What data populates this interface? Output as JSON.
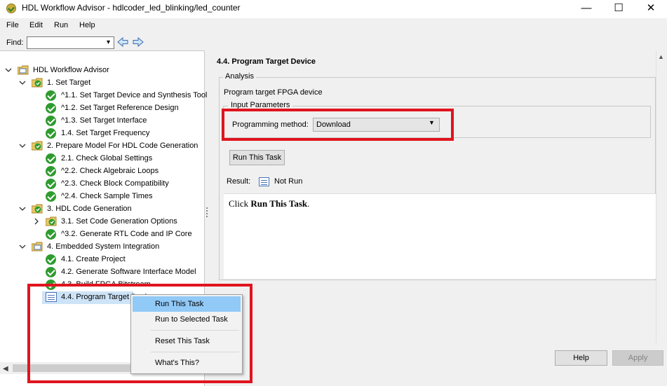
{
  "window": {
    "title": "HDL Workflow Advisor - hdlcoder_led_blinking/led_counter",
    "minimize": "—",
    "maximize": "☐",
    "close": "✕"
  },
  "menubar": [
    "File",
    "Edit",
    "Run",
    "Help"
  ],
  "find": {
    "label": "Find:",
    "value": "",
    "dropdown_glyph": "▾",
    "back_icon": "back-arrow-icon",
    "forward_icon": "forward-arrow-icon"
  },
  "tree": {
    "root": "HDL Workflow Advisor",
    "items": [
      {
        "label": "1. Set Target"
      },
      {
        "label": "^1.1. Set Target Device and Synthesis Tool"
      },
      {
        "label": "^1.2. Set Target Reference Design"
      },
      {
        "label": "^1.3. Set Target Interface"
      },
      {
        "label": "1.4. Set Target Frequency"
      },
      {
        "label": "2. Prepare Model For HDL Code Generation"
      },
      {
        "label": "2.1. Check Global Settings"
      },
      {
        "label": "^2.2. Check Algebraic Loops"
      },
      {
        "label": "^2.3. Check Block Compatibility"
      },
      {
        "label": "^2.4. Check Sample Times"
      },
      {
        "label": "3. HDL Code Generation"
      },
      {
        "label": "3.1. Set Code Generation Options"
      },
      {
        "label": "^3.2. Generate RTL Code and IP Core"
      },
      {
        "label": "4. Embedded System Integration"
      },
      {
        "label": "4.1. Create Project"
      },
      {
        "label": "4.2. Generate Software Interface Model"
      },
      {
        "label": "4.3. Build FPGA Bitstream"
      },
      {
        "label": "4.4. Program Target Device"
      }
    ]
  },
  "task": {
    "title": "4.4. Program Target Device",
    "analysis_legend": "Analysis",
    "description": "Program target FPGA device",
    "input_legend": "Input Parameters",
    "programming_method_label": "Programming method:",
    "programming_method_value": "Download",
    "run_button": "Run This Task",
    "result_label": "Result:",
    "result_value": "Not Run",
    "message_prefix": "Click ",
    "message_bold": "Run This Task",
    "message_suffix": "."
  },
  "context_menu": {
    "items": [
      "Run This Task",
      "Run to Selected Task",
      "Reset This Task",
      "What's This?"
    ],
    "highlighted": "Run This Task"
  },
  "footer": {
    "help": "Help",
    "apply": "Apply"
  },
  "colors": {
    "highlight_box": "#e0141e",
    "check_green": "#2f9b2f",
    "selection": "#cde3f7",
    "menu_hover": "#91c9f7"
  }
}
